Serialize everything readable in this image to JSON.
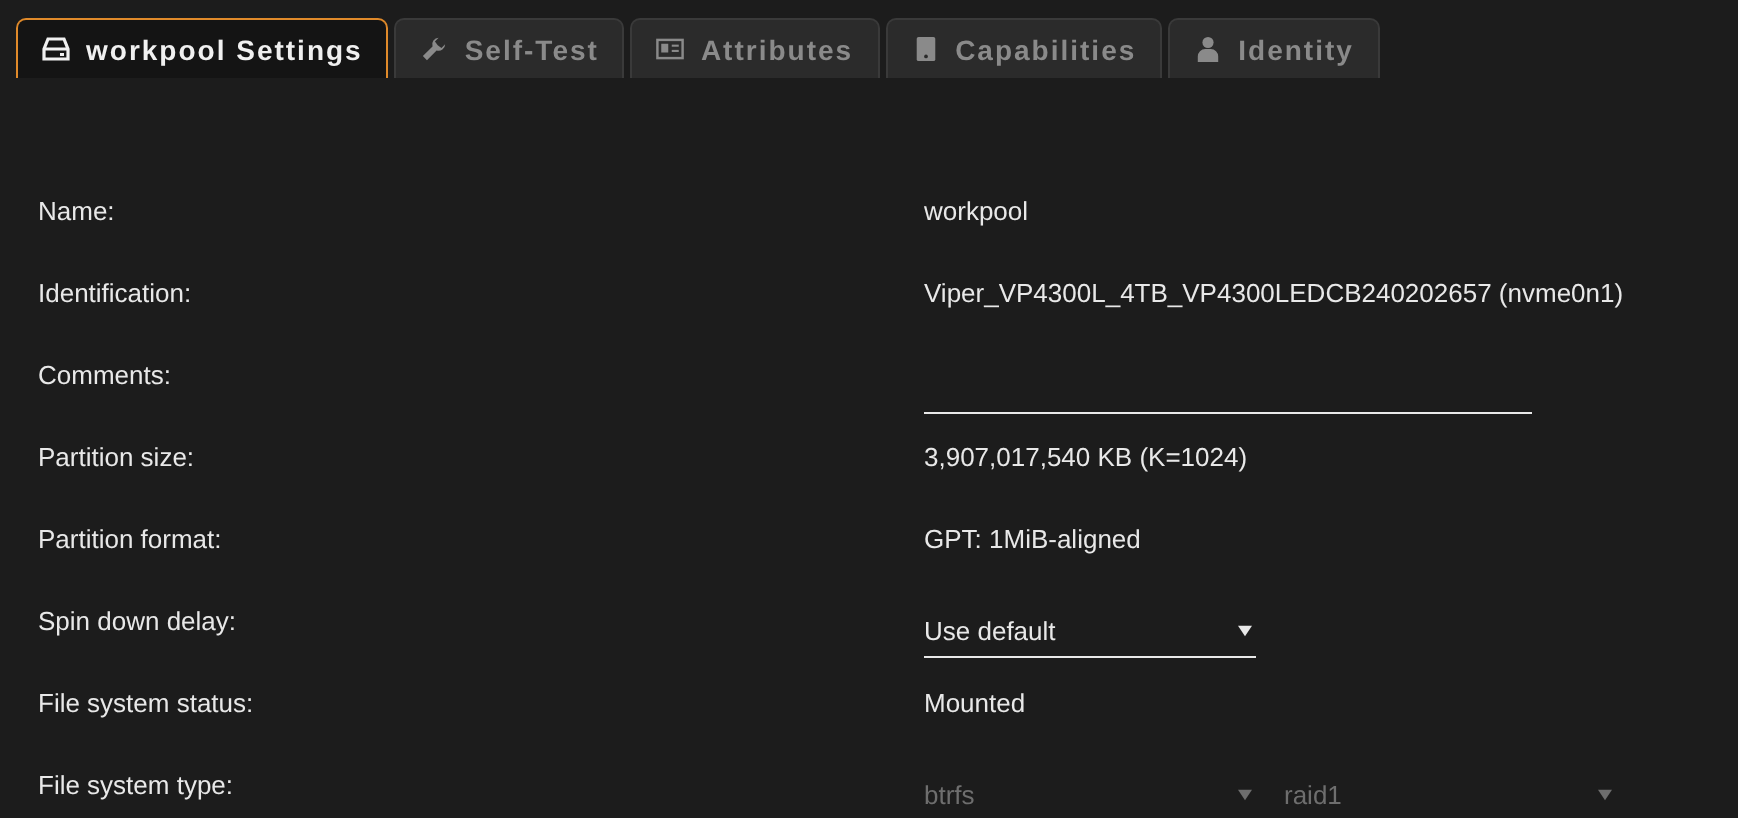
{
  "tabs": [
    {
      "label": "workpool Settings",
      "selected": true
    },
    {
      "label": "Self-Test",
      "selected": false
    },
    {
      "label": "Attributes",
      "selected": false
    },
    {
      "label": "Capabilities",
      "selected": false
    },
    {
      "label": "Identity",
      "selected": false
    }
  ],
  "fields": [
    {
      "kind": "text",
      "label": "Name:",
      "value": "workpool"
    },
    {
      "kind": "text",
      "label": "Identification:",
      "value": "Viper_VP4300L_4TB_VP4300LEDCB240202657 (nvme0n1)"
    },
    {
      "kind": "input",
      "label": "Comments:"
    },
    {
      "kind": "text",
      "label": "Partition size:",
      "value": "3,907,017,540 KB (K=1024)"
    },
    {
      "kind": "text",
      "label": "Partition format:",
      "value": "GPT: 1MiB-aligned"
    },
    {
      "kind": "select",
      "label": "Spin down delay:",
      "selects": [
        {
          "value": "Use default",
          "disabled": false
        }
      ]
    },
    {
      "kind": "text",
      "label": "File system status:",
      "value": "Mounted"
    },
    {
      "kind": "select",
      "label": "File system type:",
      "selects": [
        {
          "value": "btrfs",
          "disabled": true
        },
        {
          "value": "raid1",
          "disabled": true
        }
      ]
    }
  ]
}
